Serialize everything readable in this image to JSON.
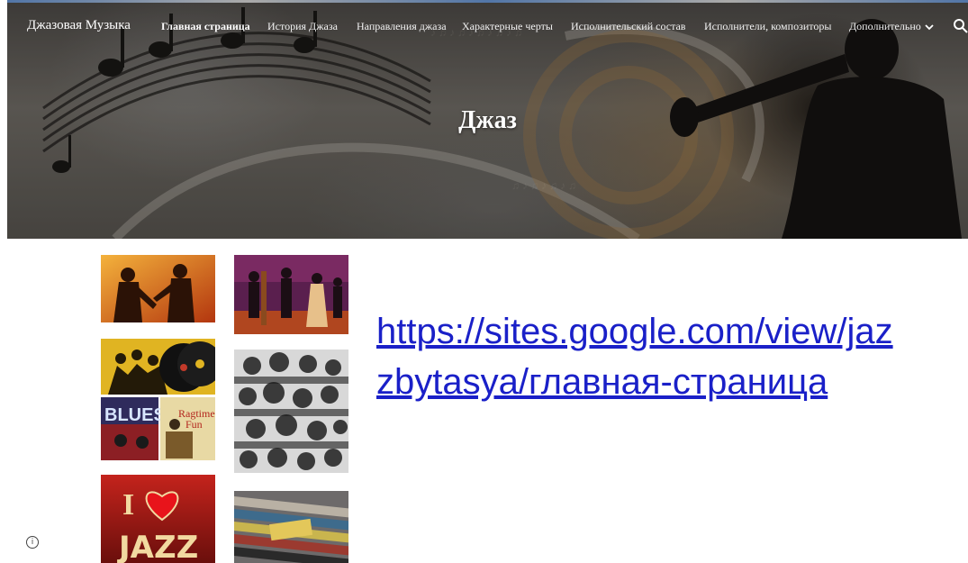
{
  "site": {
    "title": "Джазовая Музыка"
  },
  "nav": {
    "items": [
      {
        "label": "Главная страница",
        "active": true
      },
      {
        "label": "История Джаза",
        "active": false
      },
      {
        "label": "Направления джаза",
        "active": false
      },
      {
        "label": "Характерные черты",
        "active": false
      },
      {
        "label": "Исполнительский состав",
        "active": false
      },
      {
        "label": "Исполнители, композиторы",
        "active": false
      },
      {
        "label": "Дополнительно",
        "active": false,
        "has_dropdown": true
      }
    ],
    "dropdown_icon": "chevron-down-icon",
    "search_icon": "search-icon"
  },
  "hero": {
    "title": "Джаз"
  },
  "collage": [
    {
      "name": "saxophone-players-image"
    },
    {
      "name": "jazz-band-painting-image"
    },
    {
      "name": "vinyl-records-image"
    },
    {
      "name": "jazz-musicians-collage-image"
    },
    {
      "name": "blues-ragtime-covers-image"
    },
    {
      "name": "i-love-jazz-image",
      "text": "JAZZ"
    },
    {
      "name": "record-crates-image"
    }
  ],
  "link": {
    "text": "https://sites.google.com/view/jazzbytasya/главная-страница"
  },
  "info_icon": "info-icon",
  "colors": {
    "link": "#1a20c8",
    "nav_text": "#ffffff"
  }
}
